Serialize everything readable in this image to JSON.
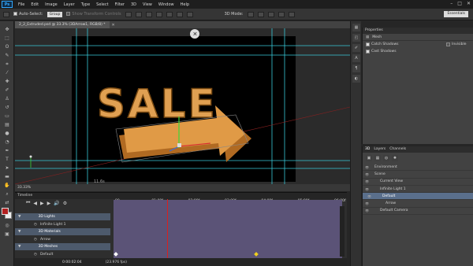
{
  "menubar": {
    "logo": "Ps",
    "items": [
      "File",
      "Edit",
      "Image",
      "Layer",
      "Type",
      "Select",
      "Filter",
      "3D",
      "View",
      "Window",
      "Help"
    ],
    "controls": [
      "–",
      "□",
      "✕"
    ]
  },
  "options": {
    "auto_select_label": "Auto-Select:",
    "auto_select_value": "Group",
    "transform_label": "Show Transform Controls",
    "mode_label": "3D Mode:",
    "workspace": "Essentials"
  },
  "document": {
    "tab_label": "2_2_Extruded.psd @ 33.3% (3DArrow1, RGB/8) *",
    "zoom": "33.33%",
    "frame_label": "11.6s",
    "headline": "SALE"
  },
  "properties": {
    "panel_title": "Properties",
    "section": "Mesh",
    "rows": [
      {
        "label": "Catch Shadows",
        "extra": "Invisible"
      },
      {
        "label": "Cast Shadows",
        "extra": ""
      }
    ]
  },
  "layers3d": {
    "tabs": [
      "3D",
      "Layers",
      "Channels"
    ],
    "rows": [
      {
        "label": "Environment",
        "indent": 0,
        "selected": false
      },
      {
        "label": "Scene",
        "indent": 0,
        "selected": false
      },
      {
        "label": "Current View",
        "indent": 1,
        "selected": false
      },
      {
        "label": "Infinite Light 1",
        "indent": 1,
        "selected": false
      },
      {
        "label": "Default",
        "indent": 1,
        "selected": true
      },
      {
        "label": "Arrow",
        "indent": 2,
        "selected": false
      },
      {
        "label": "Default Camera",
        "indent": 1,
        "selected": false
      }
    ]
  },
  "timeline": {
    "title": "Timeline",
    "controls": [
      "⏮",
      "◀",
      "▶",
      "▶",
      "🔊",
      "⚙"
    ],
    "ticks": [
      "00",
      "01:00f",
      "02:00f",
      "03:00f",
      "04:00f",
      "05:00f",
      "06:00f"
    ],
    "tracks": [
      {
        "label": "3D Lights",
        "indent": 0,
        "group": true
      },
      {
        "label": "Infinite Light 1",
        "indent": 1,
        "group": false
      },
      {
        "label": "3D Materials",
        "indent": 0,
        "group": true
      },
      {
        "label": "Arrow",
        "indent": 1,
        "group": false
      },
      {
        "label": "3D Meshes",
        "indent": 0,
        "group": true
      },
      {
        "label": "Default",
        "indent": 1,
        "group": false
      }
    ],
    "timecode": "0:00:02:04",
    "fps": "(23.976 fps)"
  },
  "colors": {
    "accent": "#31a8ff",
    "canvas": "#000000",
    "sale": "#e0a052",
    "guide": "#39c8d8",
    "track": "#5b5377",
    "playhead": "#d82020"
  }
}
